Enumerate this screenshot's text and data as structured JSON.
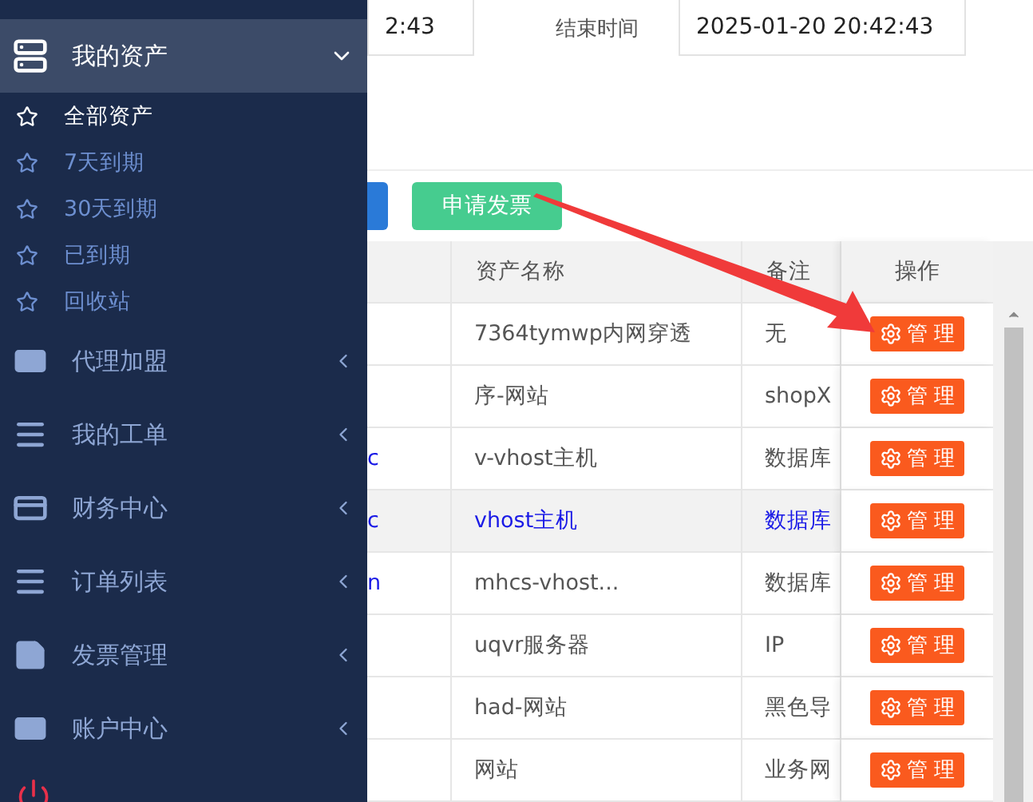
{
  "sidebar": {
    "items": [
      {
        "kind": "group",
        "label": "我的资产",
        "expanded": true,
        "children": [
          {
            "label": "全部资产",
            "selected": true
          },
          {
            "label": "7天到期",
            "selected": false
          },
          {
            "label": "30天到期",
            "selected": false
          },
          {
            "label": "已到期",
            "selected": false
          },
          {
            "label": "回收站",
            "selected": false
          }
        ]
      },
      {
        "kind": "group",
        "label": "代理加盟",
        "expanded": false
      },
      {
        "kind": "group",
        "label": "我的工单",
        "expanded": false
      },
      {
        "kind": "group",
        "label": "财务中心",
        "expanded": false
      },
      {
        "kind": "group",
        "label": "订单列表",
        "expanded": false
      },
      {
        "kind": "group",
        "label": "发票管理",
        "expanded": false
      },
      {
        "kind": "group",
        "label": "账户中心",
        "expanded": false
      },
      {
        "kind": "logout"
      }
    ]
  },
  "filter": {
    "start_value": "2:43",
    "end_label": "结束时间",
    "end_value": "2025-01-20 20:42:43"
  },
  "toolbar": {
    "invoice_button": "申请发票"
  },
  "table": {
    "columns": [
      "资产名称",
      "备注",
      "操作"
    ],
    "rows": [
      {
        "name": "7364tymwp内网穿透",
        "note": "无",
        "action": "管 理",
        "selected": false
      },
      {
        "name": "序-网站",
        "note": "shopX",
        "action": "管 理",
        "selected": false
      },
      {
        "col_1": "c",
        "name": "v-vhost主机",
        "note": "数据库",
        "action": "管 理",
        "selected": false
      },
      {
        "col_1": "c",
        "name": "vhost主机",
        "note": "数据库",
        "action": "管 理",
        "selected": true
      },
      {
        "col_1": "n",
        "name": "mhcs-vhost...",
        "note": "数据库",
        "action": "管 理",
        "selected": false
      },
      {
        "name": "uqvr服务器",
        "note": "IP",
        "action": "管 理",
        "selected": false
      },
      {
        "name": "had-网站",
        "note": "黑色导",
        "action": "管 理",
        "selected": false
      },
      {
        "name": "网站",
        "note": "业务网",
        "action": "管 理",
        "selected": false
      }
    ]
  }
}
